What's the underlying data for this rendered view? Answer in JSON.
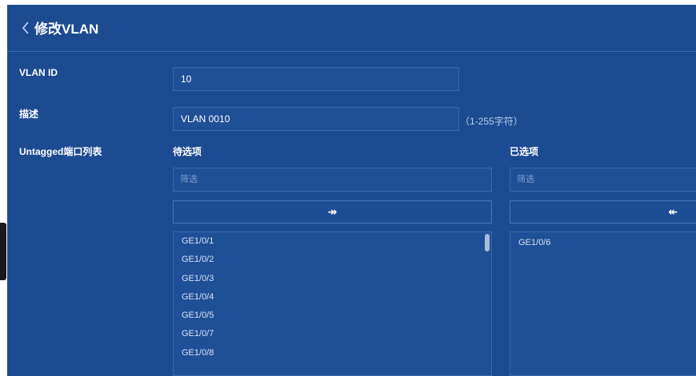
{
  "header": {
    "back_icon": "chevron-left-icon",
    "title": "修改VLAN"
  },
  "form": {
    "vlan_id": {
      "label": "VLAN ID",
      "value": "10"
    },
    "description": {
      "label": "描述",
      "value": "VLAN 0010",
      "hint": "（1-255字符）"
    },
    "untagged": {
      "label": "Untagged端口列表"
    }
  },
  "available": {
    "title": "待选项",
    "filter_placeholder": "筛选",
    "move_button": "↠",
    "items": [
      "GE1/0/1",
      "GE1/0/2",
      "GE1/0/3",
      "GE1/0/4",
      "GE1/0/5",
      "GE1/0/7",
      "GE1/0/8"
    ]
  },
  "selected": {
    "title": "已选项",
    "filter_placeholder": "筛选",
    "move_button": "↞",
    "items": [
      "GE1/0/6"
    ]
  },
  "colors": {
    "panel": "#1c4b91",
    "field": "#1f4f97",
    "border": "#3b68ad"
  }
}
